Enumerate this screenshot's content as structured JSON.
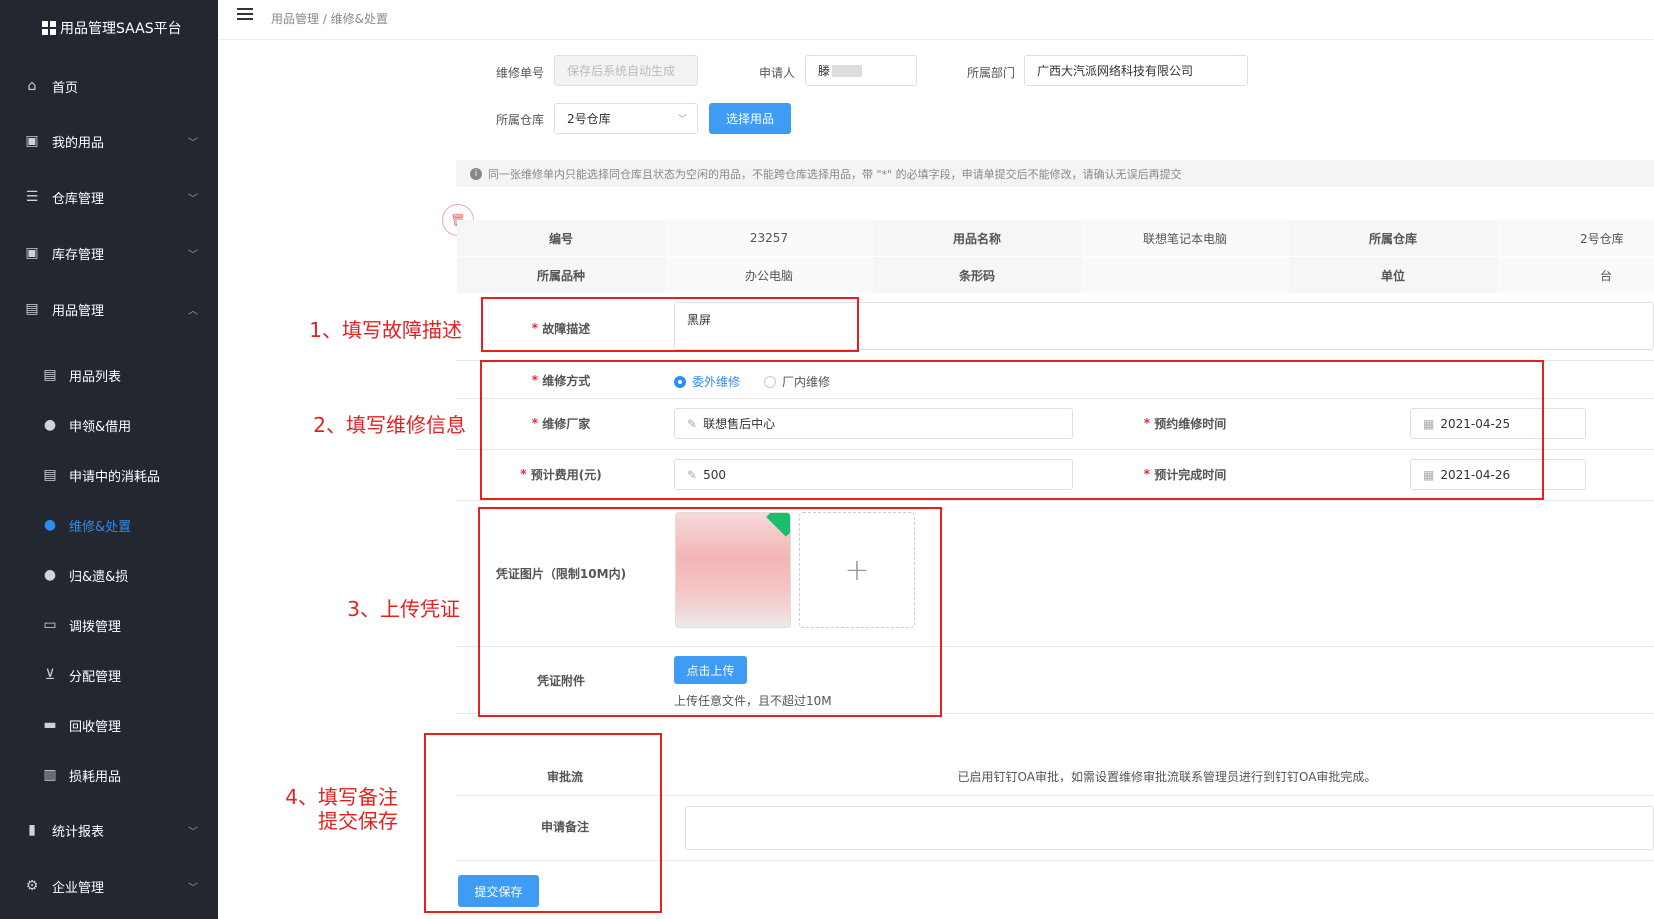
{
  "app": {
    "title": "用品管理SAAS平台"
  },
  "nav": {
    "home": "首页",
    "my_items": "我的用品",
    "warehouse": "仓库管理",
    "stock": "库存管理",
    "item_mgmt": "用品管理",
    "sub": {
      "list": "用品列表",
      "borrow": "申领&借用",
      "consumables": "申请中的消耗品",
      "repair": "维修&处置",
      "return": "归&遗&损",
      "transfer": "调拨管理",
      "assign": "分配管理",
      "recycle": "回收管理",
      "loss": "损耗用品"
    },
    "report": "统计报表",
    "enterprise": "企业管理"
  },
  "breadcrumb": "用品管理 / 维修&处置",
  "form": {
    "order_no_label": "维修单号",
    "order_no_placeholder": "保存后系统自动生成",
    "applicant_label": "申请人",
    "applicant_value": "滕",
    "dept_label": "所属部门",
    "dept_value": "广西大汽派网络科技有限公司",
    "warehouse_label": "所属仓库",
    "warehouse_value": "2号仓库",
    "select_items_button": "选择用品",
    "tip": "同一张维修单内只能选择同仓库且状态为空闲的用品，不能跨仓库选择用品，带 \"*\" 的必填字段，申请单提交后不能修改，请确认无误后再提交"
  },
  "item_table": {
    "row1": [
      "编号",
      "23257",
      "用品名称",
      "联想笔记本电脑",
      "所属仓库",
      "2号仓库"
    ],
    "row2": [
      "所属品种",
      "办公电脑",
      "条形码",
      "",
      "单位",
      "台"
    ]
  },
  "fault": {
    "label": "故障描述",
    "value": "黑屏"
  },
  "repair": {
    "method_label": "维修方式",
    "opt_external": "委外维修",
    "opt_internal": "厂内维修",
    "vendor_label": "维修厂家",
    "vendor_value": "联想售后中心",
    "appoint_label": "预约维修时间",
    "appoint_value": "2021-04-25",
    "cost_label": "预计费用(元)",
    "cost_value": "500",
    "finish_label": "预计完成时间",
    "finish_value": "2021-04-26"
  },
  "voucher": {
    "pic_label": "凭证图片（限制10M内)",
    "plus": "+",
    "attach_label": "凭证附件",
    "upload_button": "点击上传",
    "upload_hint": "上传任意文件，且不超过10M"
  },
  "approval": {
    "label": "审批流",
    "text": "已启用钉钉OA审批，如需设置维修审批流联系管理员进行到钉钉OA审批完成。"
  },
  "remark": {
    "label": "申请备注"
  },
  "submit_button": "提交保存",
  "annotations": {
    "a1": "1、填写故障描述",
    "a2": "2、填写维修信息",
    "a3": "3、上传凭证",
    "a4a": "4、填写备注",
    "a4b": "提交保存"
  },
  "colors": {
    "sidebar": "#23272f",
    "primary": "#3f9cf5",
    "annotation": "#e52020"
  }
}
